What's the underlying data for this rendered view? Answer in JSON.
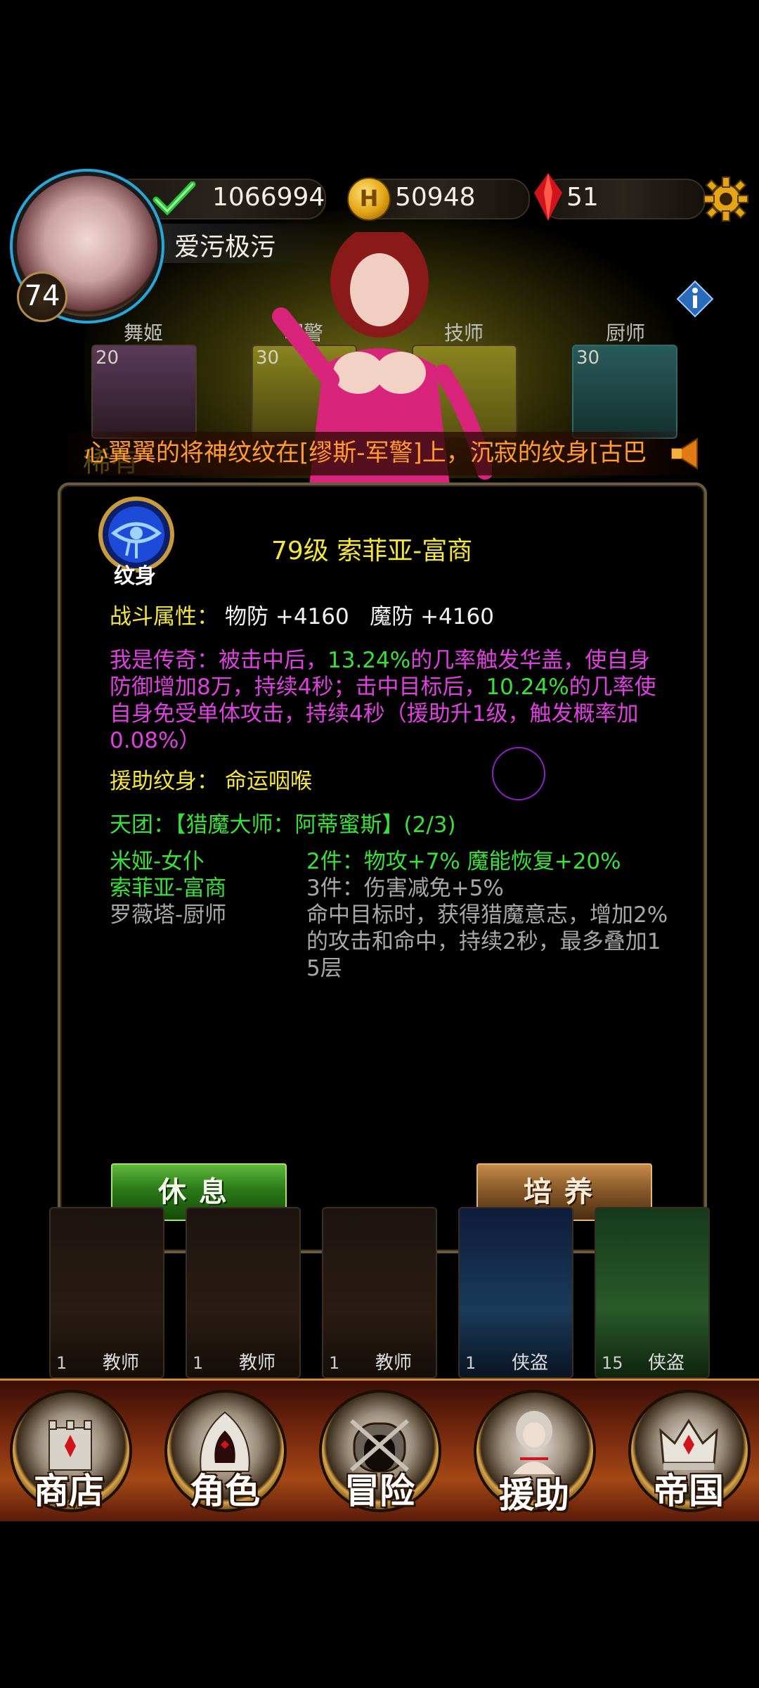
{
  "player": {
    "name": "爱污极污",
    "level": "74"
  },
  "resources": {
    "power": "1066994",
    "gold": "50948",
    "gems": "51"
  },
  "characters": [
    {
      "role": "舞姬",
      "num": "20"
    },
    {
      "role": "军警",
      "num": "30"
    },
    {
      "role": "技师",
      "num": ""
    },
    {
      "role": "厨师",
      "num": "30"
    }
  ],
  "faded_label": "稀有",
  "ticker": "心翼翼的将神纹纹在[缪斯-军警]上，沉寂的纹身[古巴",
  "dialog": {
    "badge_label": "纹身",
    "title": "79级 索菲亚-富商",
    "combat_label": "战斗属性：",
    "combat_values": "物防 +4160   魔防 +4160",
    "skill_lines": [
      {
        "t": "我是传奇：被击中后，",
        "c": "#e040e0"
      },
      {
        "t": "13.24%",
        "c": "#39e039"
      },
      {
        "t": "的几率触发华盖，使自身防御增加8万，持续4秒；击中目标后，",
        "c": "#e040e0"
      },
      {
        "t": "10.24%",
        "c": "#39e039"
      },
      {
        "t": "的几率使自身免受单体攻击，持续4秒（援助升1级，触发概率加0.08%）",
        "c": "#e040e0"
      }
    ],
    "assist_label": "援助纹身：",
    "assist_value": "命运咽喉",
    "team_title": "天团：【猎魔大师：阿蒂蜜斯】(2/3)",
    "team_members": [
      {
        "name": "米娅-女仆",
        "active": true
      },
      {
        "name": "索菲亚-富商",
        "active": true
      },
      {
        "name": "罗薇塔-厨师",
        "active": false
      }
    ],
    "set_bonuses": [
      {
        "text": "2件：物攻+7% 魔能恢复+20%",
        "active": true
      },
      {
        "text": "3件：伤害减免+5%",
        "active": false
      },
      {
        "text": "命中目标时，获得猎魔意志，增加2%的攻击和命中，持续2秒，最多叠加15层",
        "active": false
      }
    ],
    "rest_button": "休息",
    "train_button": "培养"
  },
  "lower_cards": [
    {
      "num": "1",
      "job": "教师"
    },
    {
      "num": "1",
      "job": "教师"
    },
    {
      "num": "1",
      "job": "教师"
    },
    {
      "num": "1",
      "job": "侠盗"
    },
    {
      "num": "15",
      "job": "侠盗"
    }
  ],
  "nav": [
    {
      "label": "商店",
      "icon": "castle-icon"
    },
    {
      "label": "角色",
      "icon": "hood-icon"
    },
    {
      "label": "冒险",
      "icon": "dungeon-gate-icon"
    },
    {
      "label": "援助",
      "icon": "girl-portrait-icon"
    },
    {
      "label": "帝国",
      "icon": "crown-icon"
    }
  ],
  "colors": {
    "title_yellow": "#f5e63c",
    "skill_magenta": "#e040e0",
    "highlight_green": "#39e039",
    "muted_gray": "#a8a8a8",
    "ticker_orange": "#ff9b2f",
    "gold_border": "#b38b4a"
  }
}
